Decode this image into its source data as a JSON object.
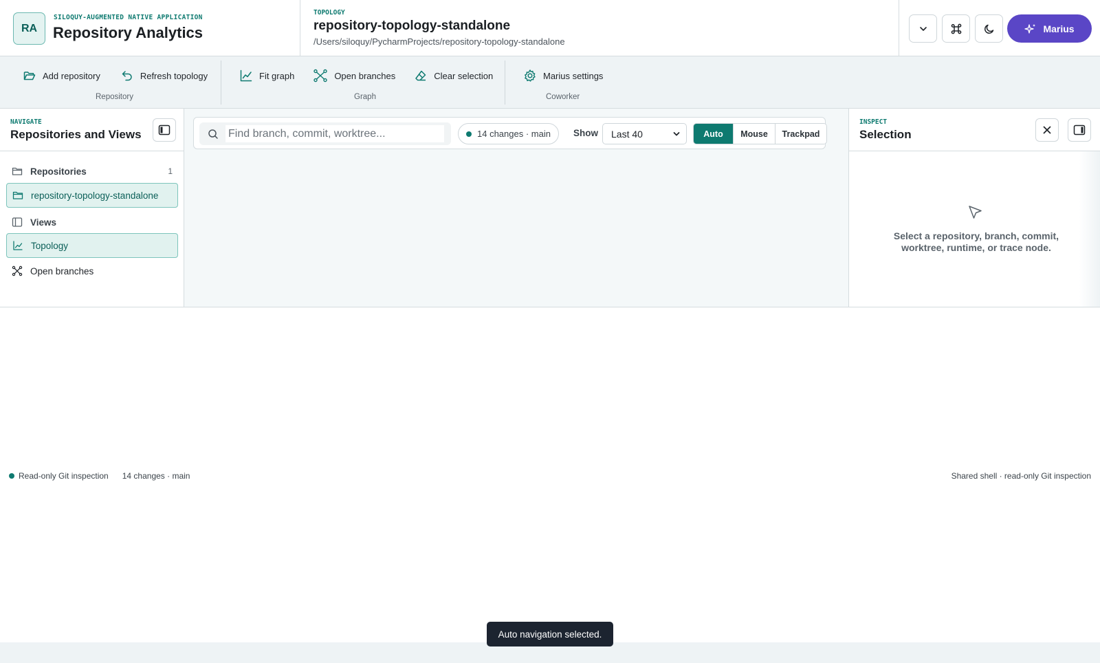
{
  "header": {
    "logo_initials": "RA",
    "kicker": "SILOQUY-AUGMENTED NATIVE APPLICATION",
    "title": "Repository Analytics",
    "context_kicker": "TOPOLOGY",
    "context_title": "repository-topology-standalone",
    "context_path": "/Users/siloquy/PycharmProjects/repository-topology-standalone",
    "assistant_button_label": "Marius"
  },
  "ribbon": {
    "groups": [
      {
        "label": "Repository",
        "items": [
          {
            "label": "Add repository",
            "icon": "folder-open-icon"
          },
          {
            "label": "Refresh topology",
            "icon": "undo-arrow-icon"
          }
        ]
      },
      {
        "label": "Graph",
        "items": [
          {
            "label": "Fit graph",
            "icon": "line-chart-icon"
          },
          {
            "label": "Open branches",
            "icon": "branches-icon"
          },
          {
            "label": "Clear selection",
            "icon": "eraser-icon"
          }
        ]
      },
      {
        "label": "Coworker",
        "items": [
          {
            "label": "Marius settings",
            "icon": "gear-icon"
          }
        ]
      }
    ]
  },
  "sidebar": {
    "kicker": "NAVIGATE",
    "title": "Repositories and Views",
    "repositories_label": "Repositories",
    "repositories_count": "1",
    "repository_item": "repository-topology-standalone",
    "views_label": "Views",
    "views": [
      {
        "label": "Topology"
      },
      {
        "label": "Open branches"
      }
    ]
  },
  "toolbar": {
    "search_placeholder": "Find branch, commit, worktree...",
    "changes_chip": "14 changes · main",
    "show_label": "Show",
    "show_value": "Last 40",
    "navigation_modes": [
      "Auto",
      "Mouse",
      "Trackpad"
    ],
    "active_mode": "Auto"
  },
  "inspector": {
    "kicker": "INSPECT",
    "title": "Selection",
    "empty_text": "Select a repository, branch, commit, worktree, runtime, or trace node."
  },
  "status": {
    "left_text": "Read-only Git inspection",
    "changes": "14 changes · main",
    "right_text": "Shared shell · read-only Git inspection"
  },
  "toast": {
    "text": "Auto navigation selected."
  },
  "colors": {
    "accent": "#0e7a70",
    "assistant": "#5a46c6",
    "toast_bg": "#1c2430"
  }
}
